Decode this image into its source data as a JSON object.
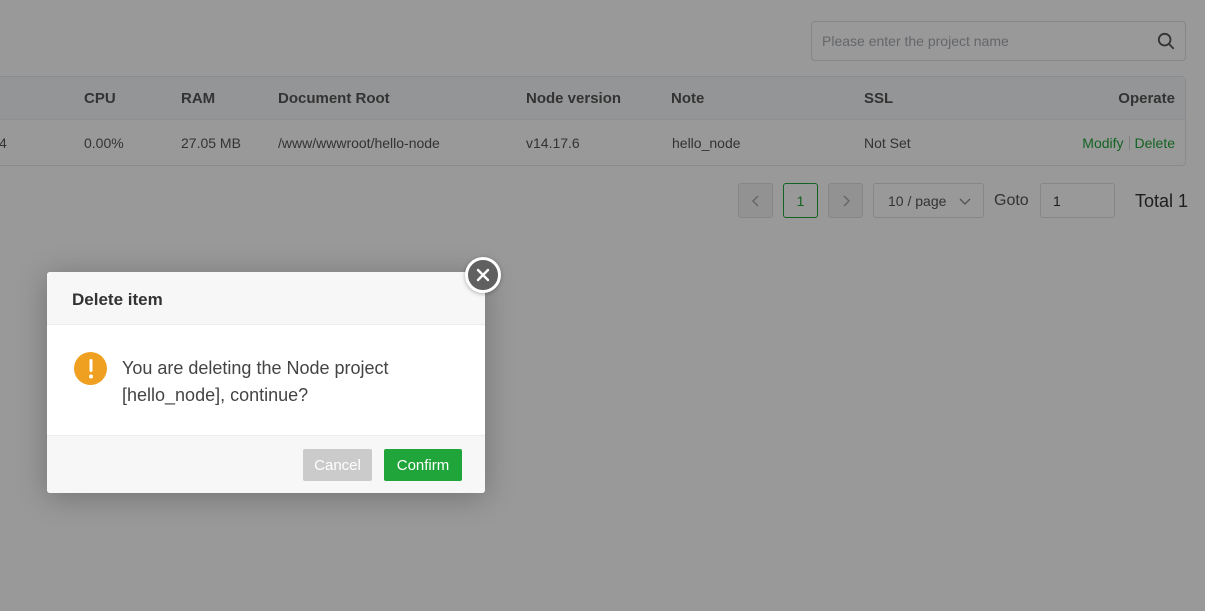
{
  "search": {
    "placeholder": "Please enter the project name",
    "icon": "search-icon"
  },
  "table": {
    "headers": [
      "CPU",
      "RAM",
      "Document Root",
      "Node version",
      "Note",
      "SSL",
      "Operate"
    ],
    "rows": [
      {
        "pid_partial": "4",
        "cpu": "0.00%",
        "ram": "27.05 MB",
        "document_root": "/www/wwwroot/hello-node",
        "node_version": "v14.17.6",
        "note": "hello_node",
        "ssl": "Not Set",
        "modify": "Modify",
        "delete": "Delete"
      }
    ]
  },
  "pagination": {
    "current_page": "1",
    "page_size": "10 / page",
    "goto_label": "Goto",
    "goto_value": "1",
    "total": "Total 1"
  },
  "dialog": {
    "title": "Delete item",
    "message": "You are deleting the Node project [hello_node], continue?",
    "cancel_label": "Cancel",
    "confirm_label": "Confirm",
    "icon": "warning-icon"
  },
  "colors": {
    "accent": "#20a53a",
    "warning": "#e6a23c",
    "warning_icon": "#f0a020"
  }
}
